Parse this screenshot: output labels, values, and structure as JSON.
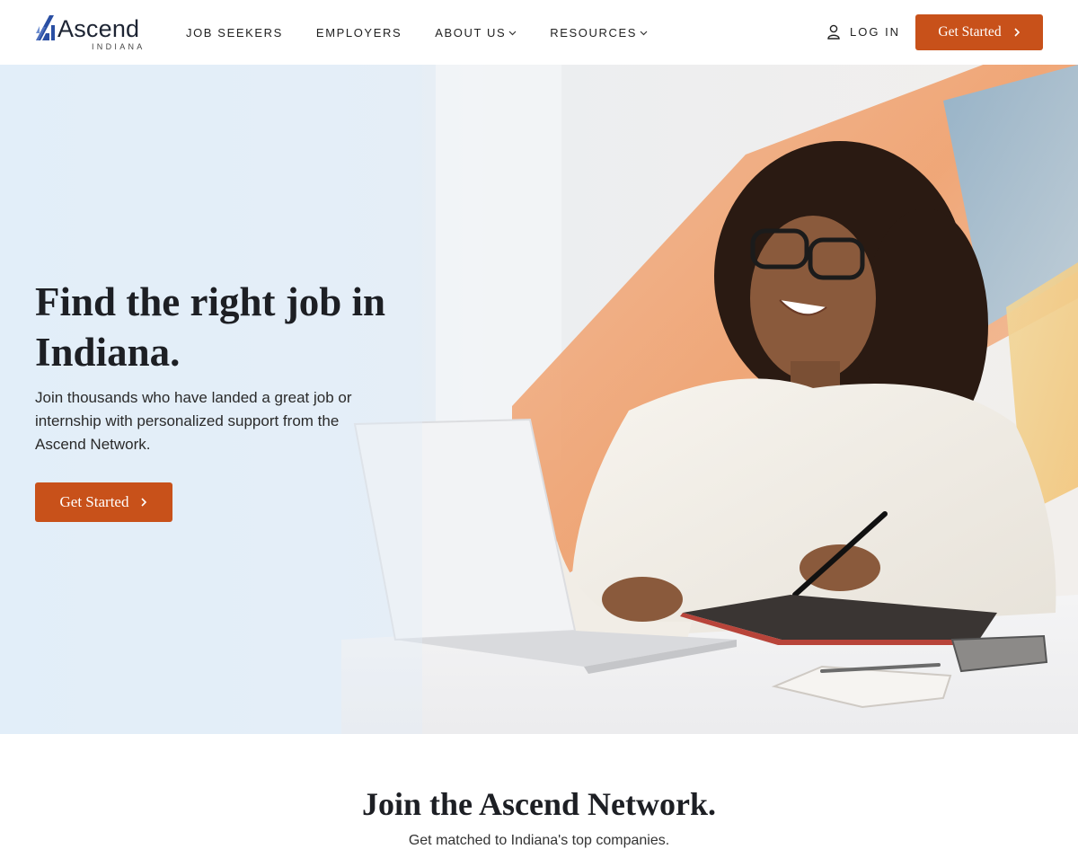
{
  "header": {
    "logo_word": "Ascend",
    "logo_sub": "INDIANA",
    "nav": [
      {
        "label": "JOB SEEKERS",
        "has_dropdown": false
      },
      {
        "label": "EMPLOYERS",
        "has_dropdown": false
      },
      {
        "label": "ABOUT US",
        "has_dropdown": true
      },
      {
        "label": "RESOURCES",
        "has_dropdown": true
      }
    ],
    "login_label": "LOG IN",
    "cta_label": "Get Started"
  },
  "hero": {
    "title": "Find the right job in Indiana.",
    "text": "Join thousands who have landed a great job or internship with personalized support from the Ascend Network.",
    "cta_label": "Get Started"
  },
  "network": {
    "title": "Join the Ascend Network.",
    "subtitle": "Get matched to Indiana's top companies."
  },
  "colors": {
    "accent": "#c8511a",
    "logo_blue": "#2a4fa3",
    "hero_bg": "#e3eef8",
    "text_dark": "#1d1f24"
  },
  "icons": [
    "ascend-logo-mark",
    "chevron-down-icon",
    "user-icon",
    "chevron-right-icon"
  ]
}
